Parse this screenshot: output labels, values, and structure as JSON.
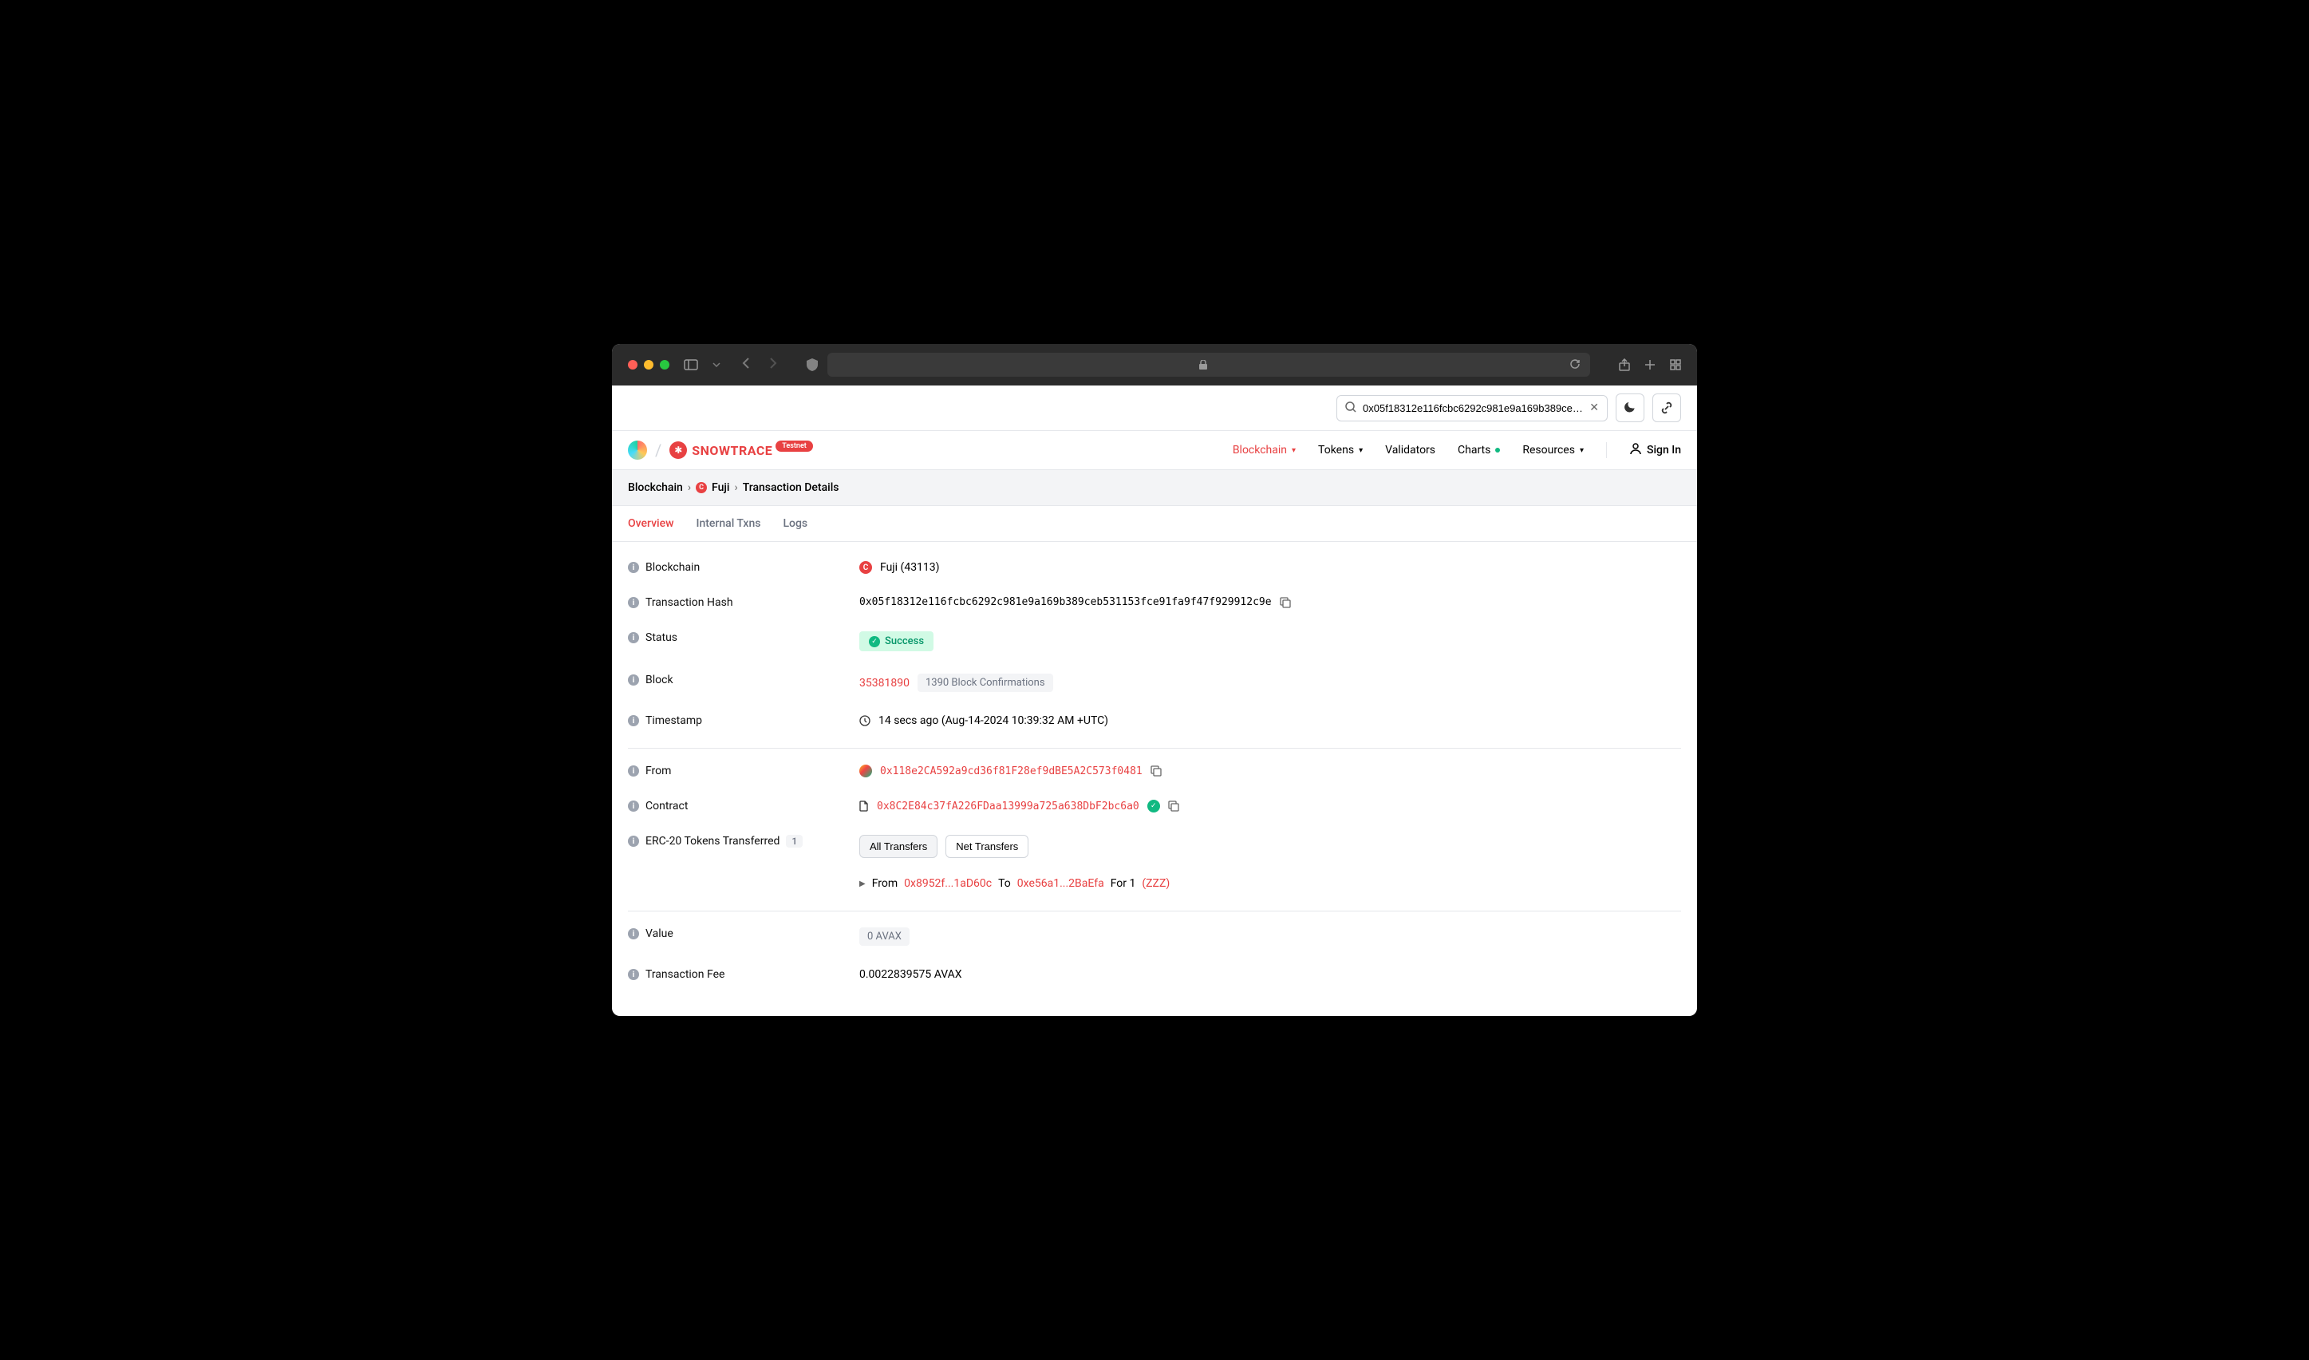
{
  "search": {
    "value": "0x05f18312e116fcbc6292c981e9a169b389ceb5311"
  },
  "brand": {
    "name": "SNOWTRACE",
    "badge": "Testnet"
  },
  "nav": {
    "blockchain": "Blockchain",
    "tokens": "Tokens",
    "validators": "Validators",
    "charts": "Charts",
    "resources": "Resources",
    "signin": "Sign In"
  },
  "breadcrumb": {
    "a": "Blockchain",
    "b": "Fuji",
    "c": "Transaction Details"
  },
  "tabs": {
    "overview": "Overview",
    "internal": "Internal Txns",
    "logs": "Logs"
  },
  "labels": {
    "blockchain": "Blockchain",
    "hash": "Transaction Hash",
    "status": "Status",
    "block": "Block",
    "timestamp": "Timestamp",
    "from": "From",
    "contract": "Contract",
    "erc20": "ERC-20 Tokens Transferred",
    "value": "Value",
    "fee": "Transaction Fee"
  },
  "fields": {
    "blockchain": "Fuji (43113)",
    "hash": "0x05f18312e116fcbc6292c981e9a169b389ceb531153fce91fa9f47f929912c9e",
    "status": "Success",
    "block": "35381890",
    "confirmations": "1390 Block Confirmations",
    "timestamp": "14 secs ago (Aug-14-2024 10:39:32 AM +UTC)",
    "from": "0x118e2CA592a9cd36f81F28ef9dBE5A2C573f0481",
    "contract": "0x8C2E84c37fA226FDaa13999a725a638DbF2bc6a0",
    "erc20_count": "1",
    "value_badge": "0 AVAX",
    "fee": "0.0022839575 AVAX"
  },
  "transfer": {
    "all": "All Transfers",
    "net": "Net Transfers",
    "from_label": "From",
    "from_addr": "0x8952f...1aD60c",
    "to_label": "To",
    "to_addr": "0xe56a1...2BaEfa",
    "for_label": "For 1",
    "token": "(ZZZ)"
  }
}
